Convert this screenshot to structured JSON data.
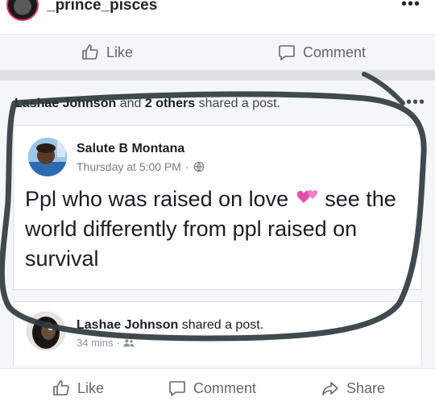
{
  "ig": {
    "username": "_prince_pisces",
    "more_icon": "more-horizontal-icon"
  },
  "top_actions": {
    "like_label": "Like",
    "comment_label": "Comment"
  },
  "shared": {
    "sharer": "Lashae Johnson",
    "connector": "and",
    "others": "2 others",
    "action": "shared a post."
  },
  "post": {
    "author": "Salute B Montana",
    "timestamp": "Thursday at 5:00 PM",
    "separator": "·",
    "privacy_icon": "globe-icon",
    "text_before": "Ppl who was raised on love",
    "emoji": "two-hearts-emoji",
    "text_after": "see the world differently from ppl raised on survival"
  },
  "second_post": {
    "author": "Lashae Johnson",
    "action": "shared a post.",
    "time": "34 mins",
    "separator": "·",
    "audience_icon": "friends-icon"
  },
  "bottom_actions": {
    "like_label": "Like",
    "comment_label": "Comment",
    "share_label": "Share"
  },
  "colors": {
    "facebook_gray_text": "#65676b",
    "scribble": "#2f3a3f",
    "ig_story_ring": "#e1306c"
  }
}
